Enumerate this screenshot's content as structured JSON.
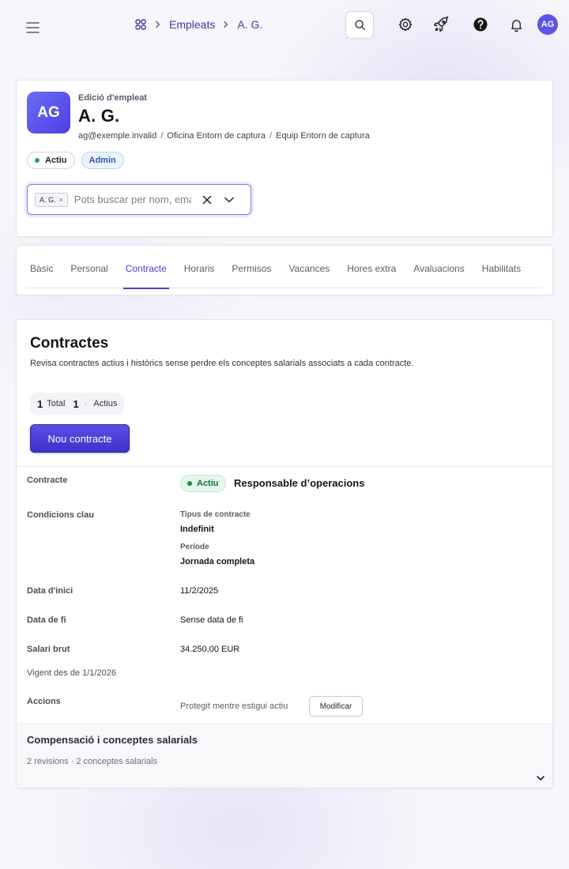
{
  "topbar": {
    "breadcrumb": [
      {
        "label": "Empleats"
      },
      {
        "label": "A. G."
      }
    ],
    "user_initials": "AG",
    "icons": [
      "menu-icon",
      "apps-grid-icon",
      "search-icon",
      "gear-icon",
      "rocket-icon",
      "help-icon",
      "bell-icon"
    ]
  },
  "employee": {
    "edit_label": "Edició d'empleat",
    "initials": "AG",
    "name": "A. G.",
    "email": "ag@exemple.invalid",
    "office": "Oficina Entorn de captura",
    "team": "Equip Entorn de captura",
    "sep": "/",
    "status_badge": "Actiu",
    "role_badge": "Admin"
  },
  "employee_select": {
    "chip_label": "A. G.",
    "chip_remove": "×",
    "placeholder": "Pots buscar per nom, email o ID"
  },
  "tabs": [
    {
      "label": "Bàsic"
    },
    {
      "label": "Personal"
    },
    {
      "label": "Contracte",
      "active": true
    },
    {
      "label": "Horaris"
    },
    {
      "label": "Permisos"
    },
    {
      "label": "Vacances"
    },
    {
      "label": "Hores extra"
    },
    {
      "label": "Avaluacions"
    },
    {
      "label": "Habilitats"
    }
  ],
  "contracts": {
    "title": "Contractes",
    "description": "Revisa contractes actius i històrics sense perdre els conceptes salarials associats a cada contracte.",
    "total_count": "1",
    "total_label": "Total",
    "active_count": "1",
    "dot": "·",
    "active_label": "Actius",
    "new_button": "Nou contracte",
    "labels": {
      "contract": "Contracte",
      "key_conditions": "Condicions clau",
      "start_date": "Data d'inici",
      "end_date": "Data de fi",
      "gross_salary": "Salari brut",
      "actions": "Accions"
    },
    "item": {
      "status": "Actiu",
      "role": "Responsable d’operacions",
      "contract_type_label": "Tipus de contracte",
      "contract_type": "Indefinit",
      "period_label": "Període",
      "period": "Jornada completa",
      "start_date": "11/2/2025",
      "end_date": "Sense data de fi",
      "gross_salary": "34.250,00 EUR",
      "valid_from": "Vigent des de 1/1/2026",
      "protected_text": "Protegit mentre estigui actiu",
      "modify_button": "Modificar"
    },
    "compensation": {
      "title": "Compensació i conceptes salarials",
      "summary": "2 revisions · 2 conceptes salarials"
    }
  },
  "colors": {
    "accent": "#4a3fd3",
    "avatar": "#5a55e8",
    "active_green": "#1eaa52"
  }
}
